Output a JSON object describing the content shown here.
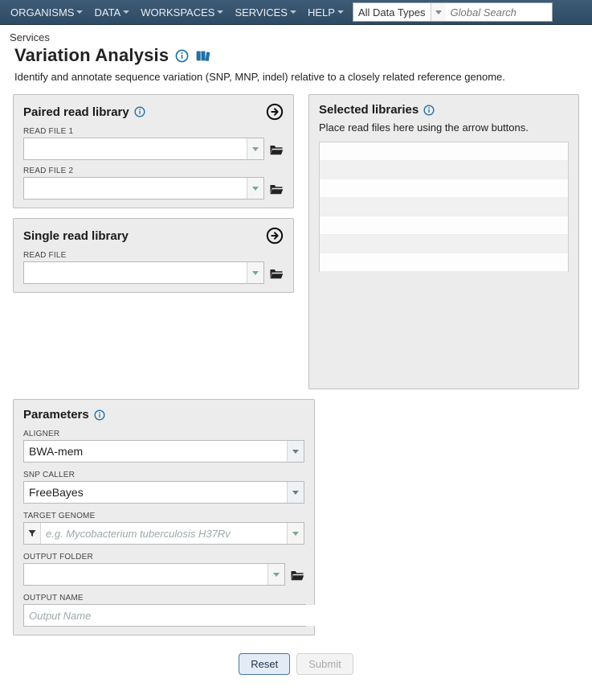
{
  "nav": {
    "items": [
      "ORGANISMS",
      "DATA",
      "WORKSPACES",
      "SERVICES",
      "HELP"
    ],
    "dataTypeSelected": "All Data Types",
    "searchPlaceholder": "Global Search"
  },
  "breadcrumb": "Services",
  "pageTitle": "Variation Analysis",
  "description": "Identify and annotate sequence variation (SNP, MNP, indel) relative to a closely related reference genome.",
  "pairedRead": {
    "title": "Paired read library",
    "file1Label": "READ FILE 1",
    "file2Label": "READ FILE 2"
  },
  "singleRead": {
    "title": "Single read library",
    "fileLabel": "READ FILE"
  },
  "selected": {
    "title": "Selected libraries",
    "note": "Place read files here using the arrow buttons."
  },
  "params": {
    "title": "Parameters",
    "alignerLabel": "ALIGNER",
    "alignerValue": "BWA-mem",
    "snpCallerLabel": "SNP CALLER",
    "snpCallerValue": "FreeBayes",
    "targetGenomeLabel": "TARGET GENOME",
    "targetGenomePlaceholder": "e.g. Mycobacterium tuberculosis H37Rv",
    "outputFolderLabel": "OUTPUT FOLDER",
    "outputNameLabel": "OUTPUT NAME",
    "outputNamePlaceholder": "Output Name"
  },
  "buttons": {
    "reset": "Reset",
    "submit": "Submit"
  }
}
